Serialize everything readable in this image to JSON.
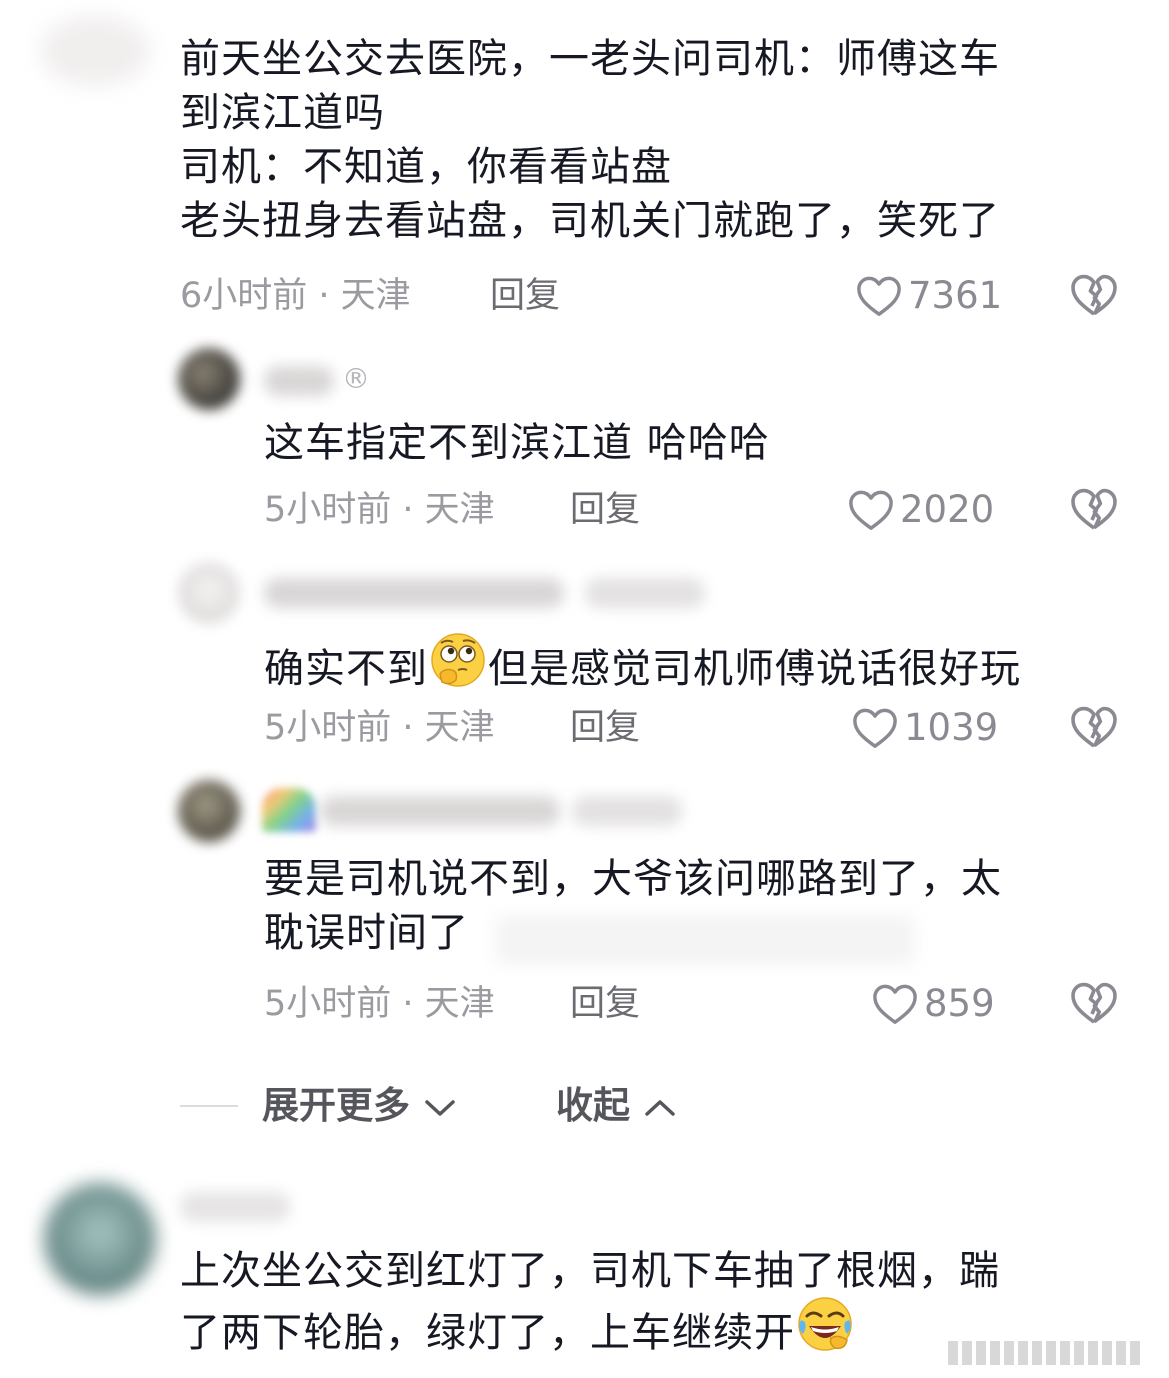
{
  "comments": [
    {
      "lines": [
        "前天坐公交去医院，一老头问司机：师傅这车",
        "到滨江道吗",
        "司机：不知道，你看看站盘",
        "老头扭身去看站盘，司机关门就跑了，笑死了"
      ],
      "meta": "6小时前 · 天津",
      "reply_label": "回复",
      "likes": "7361"
    }
  ],
  "replies": [
    {
      "name_suffix": "®",
      "text": "这车指定不到滨江道   哈哈哈",
      "meta": "5小时前 · 天津",
      "reply_label": "回复",
      "likes": "2020"
    },
    {
      "text_before": "确实不到",
      "text_after": "但是感觉司机师傅说话很好玩",
      "emoji": "thinking-face-emoji",
      "meta": "5小时前 · 天津",
      "reply_label": "回复",
      "likes": "1039"
    },
    {
      "lines": [
        "要是司机说不到，大爷该问哪路到了，太",
        "耽误时间了"
      ],
      "meta": "5小时前 · 天津",
      "reply_label": "回复",
      "likes": "859"
    }
  ],
  "expand": {
    "more_label": "展开更多",
    "collapse_label": "收起"
  },
  "bottom_comment": {
    "lines": [
      "上次坐公交到红灯了，司机下车抽了根烟，踹",
      "了两下轮胎，绿灯了，上车继续开"
    ],
    "emoji": "rolling-laughing-emoji"
  },
  "icons": {
    "like": "heart-outline-icon",
    "dislike": "broken-heart-icon",
    "chevron_down": "chevron-down-icon",
    "chevron_up": "chevron-up-icon"
  },
  "colors": {
    "text": "#161823",
    "meta": "#9a9aa0",
    "reply": "#6b6b72",
    "icon": "#8a8a92"
  }
}
